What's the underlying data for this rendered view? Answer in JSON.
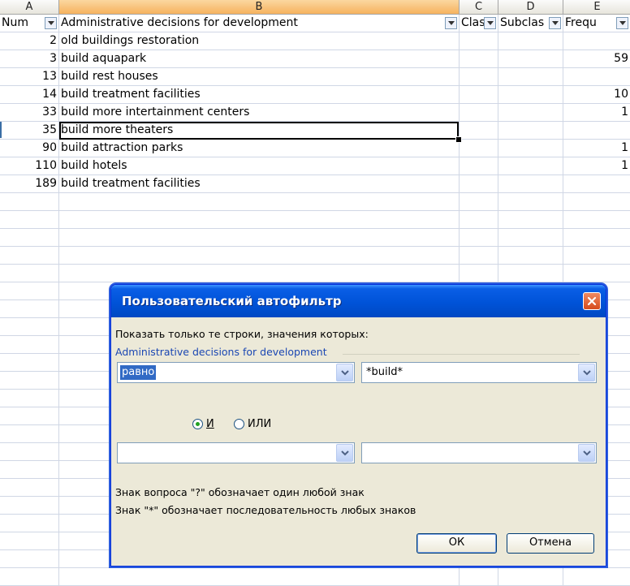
{
  "columns": [
    "A",
    "B",
    "C",
    "D",
    "E"
  ],
  "active_column": "B",
  "header_row": {
    "num": "Num",
    "decision": "Administrative decisions for development",
    "class": "Clas",
    "subclass": "Subclas",
    "frequency": "Frequ"
  },
  "rows": [
    {
      "num": "2",
      "text": "old buildings restoration",
      "e": ""
    },
    {
      "num": "3",
      "text": "build aquapark",
      "e": "59"
    },
    {
      "num": "13",
      "text": "build rest houses",
      "e": ""
    },
    {
      "num": "14",
      "text": "build treatment facilities",
      "e": "10"
    },
    {
      "num": "33",
      "text": "build more intertainment centers",
      "e": "1"
    },
    {
      "num": "35",
      "text": "build more theaters",
      "e": ""
    },
    {
      "num": "90",
      "text": "build attraction parks",
      "e": "1"
    },
    {
      "num": "110",
      "text": "build hotels",
      "e": "1"
    },
    {
      "num": "189",
      "text": "build treatment facilities",
      "e": ""
    }
  ],
  "dialog": {
    "title": "Пользовательский автофильтр",
    "instruction": "Показать только те строки, значения которых:",
    "field_name": "Administrative decisions for development",
    "condition1_operator": "равно",
    "condition1_value": "*build*",
    "condition2_operator": "",
    "condition2_value": "",
    "radio_and": "И",
    "radio_or": "ИЛИ",
    "selected_logic": "and",
    "hint1": "Знак вопроса \"?\" обозначает один любой знак",
    "hint2": "Знак \"*\" обозначает последовательность любых знаков",
    "ok_label": "ОК",
    "cancel_label": "Отмена"
  },
  "icons": {
    "dropdown": "chevron-down-icon",
    "close": "close-icon",
    "filter": "filter-dropdown-icon"
  },
  "colors": {
    "titlebar": "#0053d8",
    "dialog_bg": "#ece9d8",
    "selection": "#316ac5",
    "active_column_header": "#f6b25e"
  }
}
